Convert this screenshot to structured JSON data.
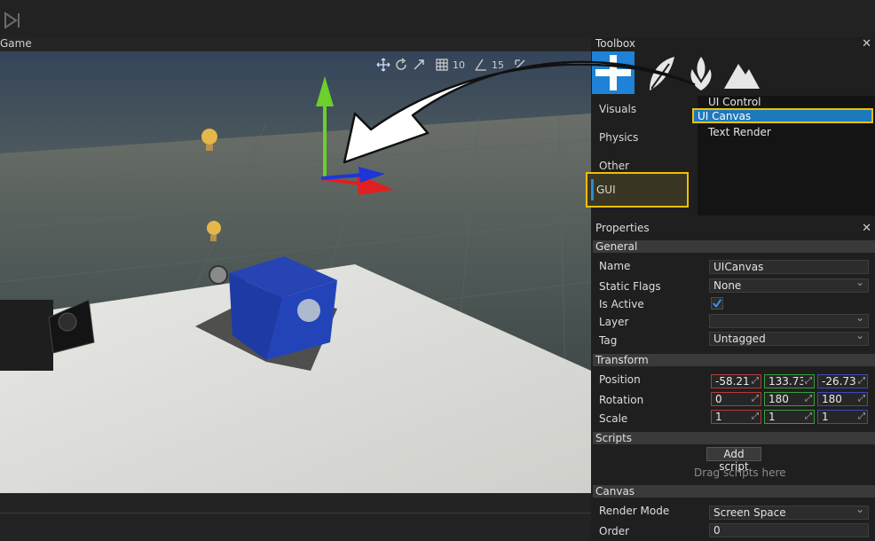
{
  "colors": {
    "accent": "#1e82d6",
    "highlight": "#f0c000",
    "selection": "#1c79bc",
    "x_axis": "#b33a3a",
    "y_axis": "#3b9e3b",
    "z_axis": "#3f48b8"
  },
  "toolbar": {
    "step_icon": "step-forward-icon"
  },
  "game": {
    "tab_label": "Game",
    "viewport_toolbar": {
      "grid_value": "10",
      "rotate_snap_value": "15"
    }
  },
  "toolbox": {
    "title": "Toolbox",
    "tool_icons": [
      "plus-icon",
      "leaf-icon",
      "tree-icon",
      "mountain-icon"
    ],
    "categories": [
      {
        "label": "Visuals"
      },
      {
        "label": "Physics"
      },
      {
        "label": "Other"
      },
      {
        "label": "GUI"
      }
    ],
    "selected_category": "GUI",
    "items": [
      {
        "label": "UI Control"
      },
      {
        "label": "UI Canvas"
      },
      {
        "label": "Text Render"
      }
    ],
    "selected_item": "UI Canvas"
  },
  "properties": {
    "title": "Properties",
    "general": {
      "header": "General",
      "name_label": "Name",
      "name_value": "UICanvas",
      "static_flags_label": "Static Flags",
      "static_flags_value": "None",
      "is_active_label": "Is Active",
      "is_active": true,
      "layer_label": "Layer",
      "layer_value": "",
      "tag_label": "Tag",
      "tag_value": "Untagged"
    },
    "transform": {
      "header": "Transform",
      "position_label": "Position",
      "position": [
        "-58.213",
        "133.73",
        "-26.736"
      ],
      "rotation_label": "Rotation",
      "rotation": [
        "0",
        "180",
        "180"
      ],
      "scale_label": "Scale",
      "scale": [
        "1",
        "1",
        "1"
      ]
    },
    "scripts": {
      "header": "Scripts",
      "add_button": "Add script",
      "hint": "Drag scripts here"
    },
    "canvas": {
      "header": "Canvas",
      "render_mode_label": "Render Mode",
      "render_mode_value": "Screen Space",
      "order_label": "Order",
      "order_value": "0"
    }
  }
}
